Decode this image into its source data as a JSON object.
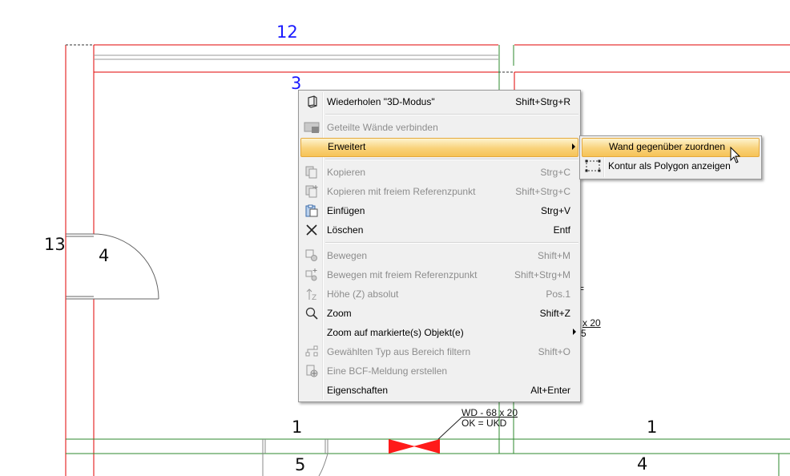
{
  "drawing": {
    "dim_labels": {
      "top_12": "12",
      "room_3": "3",
      "left_13": "13",
      "door_4": "4",
      "bottom_1_left": "1",
      "bottom_5": "5",
      "bottom_1_right": "1",
      "bottom_4": "4"
    },
    "annotations": {
      "wd_label": "WD - 68 x 20",
      "ok_label": "OK = UKD",
      "side_x20": "x 20",
      "side_5": "5",
      "side_sym": "="
    },
    "colors": {
      "wall_red": "#e00000",
      "wall_green": "#2d8a2d",
      "dim_blue": "#1a1aff",
      "marker_red": "#ff1a1a"
    }
  },
  "context_menu": {
    "items": [
      {
        "icon": "3d-box-icon",
        "label": "Wiederholen \"3D-Modus\"",
        "shortcut": "Shift+Strg+R",
        "enabled": true
      },
      {
        "separator": true
      },
      {
        "icon": "join-walls-icon",
        "label": "Geteilte Wände verbinden",
        "shortcut": "",
        "enabled": false
      },
      {
        "icon": "",
        "label": "Erweitert",
        "shortcut": "",
        "enabled": true,
        "submenu": true,
        "highlighted": true
      },
      {
        "separator": true
      },
      {
        "icon": "copy-icon",
        "label": "Kopieren",
        "shortcut": "Strg+C",
        "enabled": false
      },
      {
        "icon": "copy-ref-icon",
        "label": "Kopieren mit freiem Referenzpunkt",
        "shortcut": "Shift+Strg+C",
        "enabled": false
      },
      {
        "icon": "paste-icon",
        "label": "Einfügen",
        "shortcut": "Strg+V",
        "enabled": true
      },
      {
        "icon": "delete-x-icon",
        "label": "Löschen",
        "shortcut": "Entf",
        "enabled": true
      },
      {
        "separator": true
      },
      {
        "icon": "move-icon",
        "label": "Bewegen",
        "shortcut": "Shift+M",
        "enabled": false
      },
      {
        "icon": "move-ref-icon",
        "label": "Bewegen mit freiem Referenzpunkt",
        "shortcut": "Shift+Strg+M",
        "enabled": false
      },
      {
        "icon": "height-z-icon",
        "label": "Höhe (Z) absolut",
        "shortcut": "Pos.1",
        "enabled": false
      },
      {
        "icon": "zoom-icon",
        "label": "Zoom",
        "shortcut": "Shift+Z",
        "enabled": true
      },
      {
        "icon": "",
        "label": "Zoom auf markierte(s) Objekt(e)",
        "shortcut": "",
        "enabled": true,
        "submenu": true
      },
      {
        "icon": "filter-type-icon",
        "label": "Gewählten Typ aus Bereich filtern",
        "shortcut": "Shift+O",
        "enabled": false
      },
      {
        "icon": "bcf-icon",
        "label": "Eine BCF-Meldung erstellen",
        "shortcut": "",
        "enabled": false
      },
      {
        "icon": "",
        "label": "Eigenschaften",
        "shortcut": "Alt+Enter",
        "enabled": true
      }
    ]
  },
  "submenu": {
    "items": [
      {
        "icon": "",
        "label": "Wand gegenüber zuordnen",
        "highlighted": true
      },
      {
        "icon": "polygon-outline-icon",
        "label": "Kontur als Polygon anzeigen",
        "highlighted": false
      }
    ]
  }
}
